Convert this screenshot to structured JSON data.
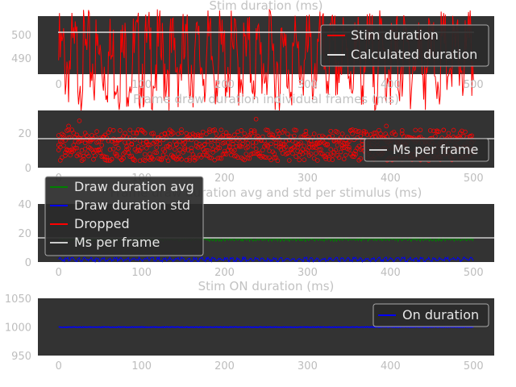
{
  "chart_data": [
    {
      "type": "line",
      "title": "Stim duration (ms)",
      "xlim": [
        -25,
        525
      ],
      "ylim": [
        483,
        508
      ],
      "xticks": [
        "0",
        "100",
        "200",
        "300",
        "400",
        "500"
      ],
      "yticks": [
        "490",
        "500"
      ],
      "series": [
        {
          "name": "Stim duration",
          "color": "#ff0000",
          "description_values": {
            "x_start": 0,
            "x_end": 500,
            "typical_range": [
              485,
              508
            ]
          }
        },
        {
          "name": "Calculated duration",
          "color": "#e0e0e0",
          "values": [
            500,
            500
          ]
        }
      ],
      "legend": "top-right",
      "grid": false
    },
    {
      "type": "scatter",
      "title": "Frame draw duration individual frames (ms)",
      "xlim": [
        -25,
        525
      ],
      "ylim": [
        0,
        33
      ],
      "xticks": [
        "0",
        "100",
        "200",
        "300",
        "400",
        "500"
      ],
      "yticks": [
        "0",
        "20"
      ],
      "series": [
        {
          "name": "Ms per frame",
          "color": "#cccccc",
          "values": [
            16.7,
            16.7
          ]
        },
        {
          "name": "",
          "color": "#ff0000",
          "typical_range": [
            5,
            22
          ],
          "outliers": [
            [
              12,
              24
            ],
            [
              25,
              27
            ],
            [
              238,
              28
            ],
            [
              395,
              24
            ]
          ]
        }
      ],
      "legend": "right",
      "grid": false
    },
    {
      "type": "line",
      "title": "Frame draw duration avg and std per stimulus (ms)",
      "xlim": [
        -25,
        525
      ],
      "ylim": [
        0,
        40
      ],
      "xticks": [
        "0",
        "100",
        "200",
        "300",
        "400",
        "500"
      ],
      "yticks": [
        "0",
        "20",
        "40"
      ],
      "series": [
        {
          "name": "Draw duration avg",
          "color": "#008000",
          "approx": 16.5
        },
        {
          "name": "Draw duration std",
          "color": "#0000ff",
          "approx": 2.5
        },
        {
          "name": "Dropped",
          "color": "#ff0000"
        },
        {
          "name": "Ms per frame",
          "color": "#cccccc",
          "values": [
            16.7,
            16.7
          ]
        }
      ],
      "legend": "top-left",
      "grid": false
    },
    {
      "type": "line",
      "title": "Stim ON duration (ms)",
      "xlim": [
        -25,
        525
      ],
      "ylim": [
        950,
        1050
      ],
      "xticks": [
        "0",
        "100",
        "200",
        "300",
        "400",
        "500"
      ],
      "yticks": [
        "950",
        "1000",
        "1050"
      ],
      "series": [
        {
          "name": "On duration",
          "color": "#0000ff",
          "approx": 1000
        }
      ],
      "legend": "top-right",
      "grid": false
    }
  ]
}
